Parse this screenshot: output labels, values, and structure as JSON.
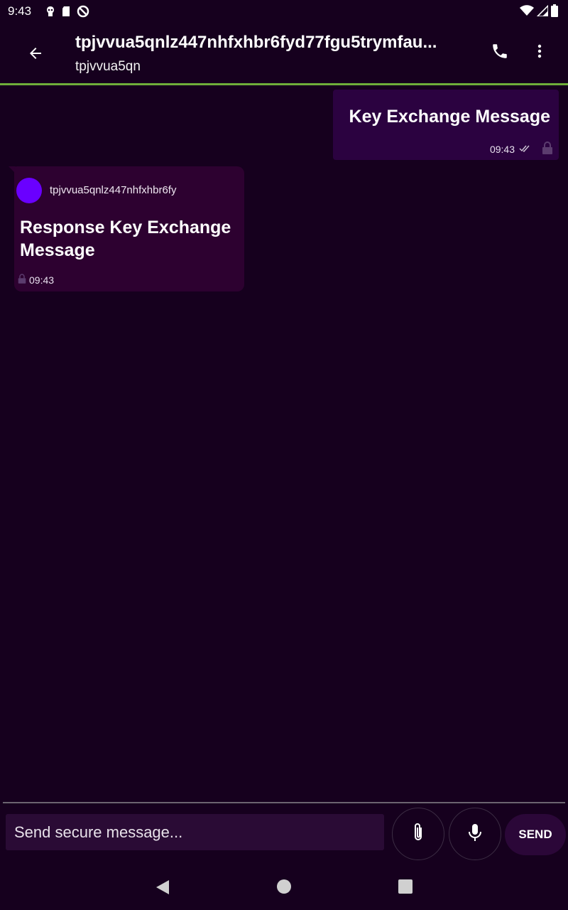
{
  "status_bar": {
    "time": "9:43",
    "left_icons": [
      "android-debug-icon",
      "sd-card-icon",
      "do-not-disturb-icon"
    ],
    "right_icons": [
      "wifi-icon",
      "signal-icon",
      "battery-icon"
    ]
  },
  "header": {
    "title": "tpjvvua5qnlz447nhfxhbr6fyd77fgu5trymfau...",
    "subtitle": "tpjvvua5qn",
    "accent_color": "#6fae3a"
  },
  "messages": [
    {
      "direction": "outgoing",
      "text": "Key Exchange Message",
      "time": "09:43",
      "status_icon": "double-check-icon",
      "encrypted_icon": "lock-icon"
    },
    {
      "direction": "incoming",
      "sender": "tpjvvua5qnlz447nhfxhbr6fy",
      "avatar_color": "#6a00ff",
      "text": "Response Key Exchange Message",
      "time": "09:43",
      "encrypted_icon": "lock-icon"
    }
  ],
  "composer": {
    "placeholder": "Send secure message...",
    "send_label": "SEND"
  },
  "nav_bar": {
    "buttons": [
      "back-icon",
      "home-icon",
      "recents-icon"
    ]
  }
}
